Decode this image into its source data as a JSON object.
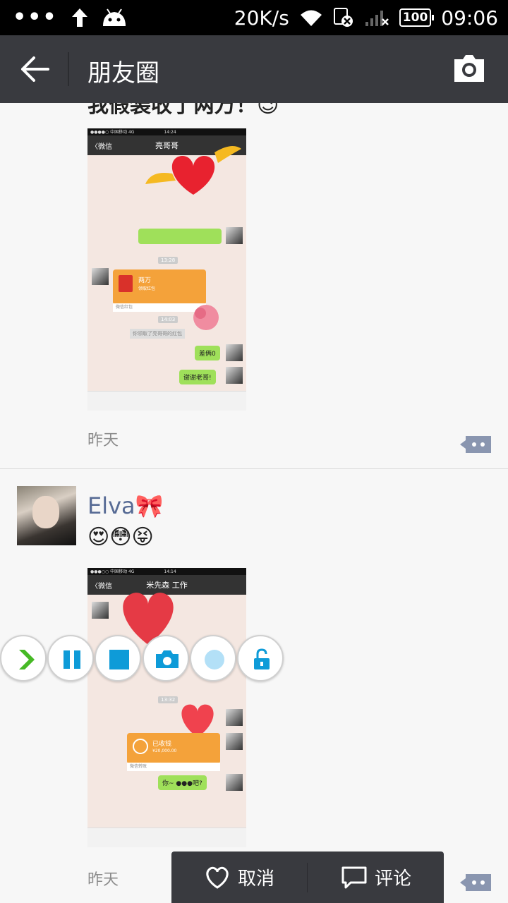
{
  "status_bar": {
    "net_speed": "20K/s",
    "battery": "100",
    "time": "09:06"
  },
  "header": {
    "title": "朋友圈"
  },
  "posts": [
    {
      "text": "我假装收了两万！😉",
      "time": "昨天",
      "shot": {
        "carrier": "●●●●○ 中国移动 4G",
        "clock": "14:24",
        "back": "〈微信",
        "contact": "亮哥哥",
        "time_chips": [
          "13:28",
          "14:03"
        ],
        "red_packet_title": "两万",
        "red_packet_sub": "领取红包",
        "red_packet_foot": "微信红包",
        "notice": "你领取了亮哥哥的红包",
        "msg1": "差俩0",
        "msg2": "谢谢老哥!"
      }
    },
    {
      "username": "Elva🎀",
      "text": "😍😳😝",
      "time": "昨天",
      "shot": {
        "carrier": "●●●○○ 中国移动 4G",
        "clock": "14:14",
        "back": "〈微信",
        "contact": "米先森 工作",
        "transfer_title": "已收钱",
        "transfer_amount": "¥20,000.00",
        "transfer_foot": "微信转账",
        "msg1": "你~ ●●●吧?",
        "time_chip": "13:32"
      }
    }
  ],
  "popup": {
    "like_label": "取消",
    "comment_label": "评论"
  },
  "float_toolbar": {
    "icons": [
      "expand-icon",
      "pause-icon",
      "stop-icon",
      "camera-icon",
      "record-icon",
      "unlock-icon"
    ]
  },
  "colors": {
    "title_bar": "#393a3f",
    "username": "#576b95",
    "accent_blue": "#0e9bd8",
    "accent_green": "#46b925"
  }
}
